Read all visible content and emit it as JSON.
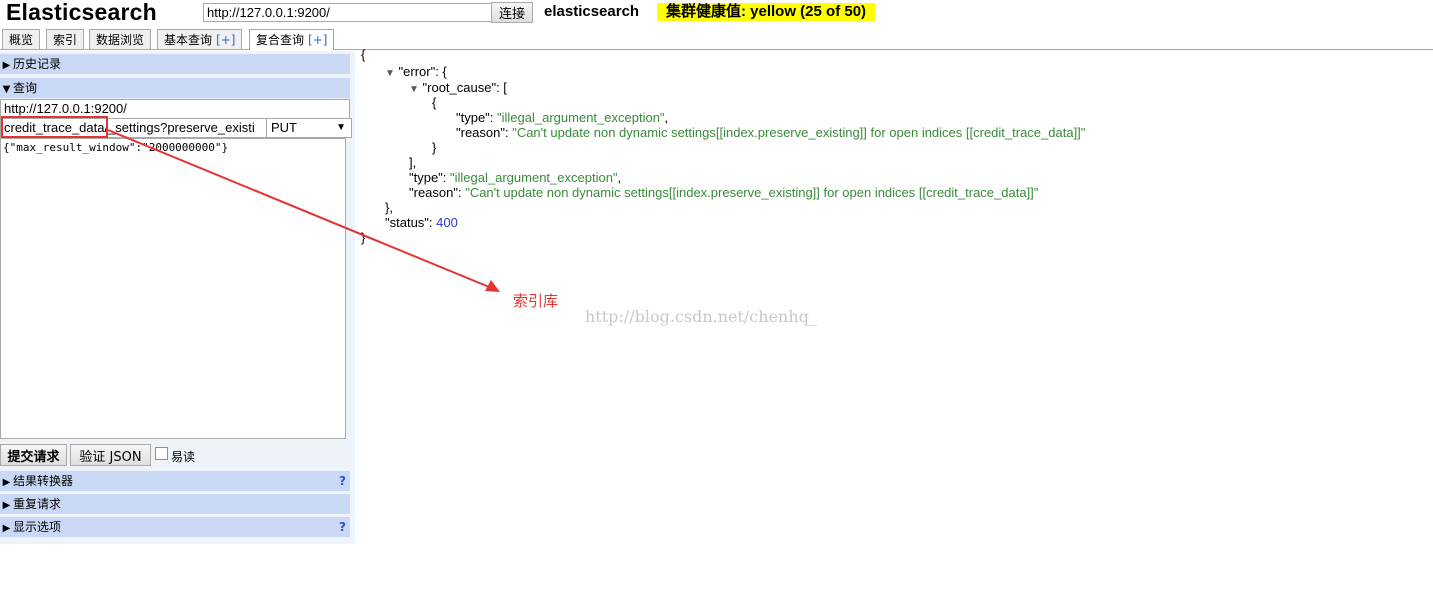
{
  "header": {
    "app_title": "Elasticsearch",
    "url_value": "http://127.0.0.1:9200/",
    "connect_label": "连接",
    "cluster_name": "elasticsearch",
    "health_text": "集群健康值: yellow (25 of 50)",
    "health_color": "#ffff00"
  },
  "tabs": [
    {
      "label": "概览",
      "plus": ""
    },
    {
      "label": "索引",
      "plus": ""
    },
    {
      "label": "数据浏览",
      "plus": ""
    },
    {
      "label": "基本查询",
      "plus": "[+]"
    },
    {
      "label": "复合查询",
      "plus": "[+]"
    }
  ],
  "left_panel": {
    "history_label": "历史记录",
    "query_label": "查询",
    "endpoint_value": "http://127.0.0.1:9200/",
    "path_value": "credit_trace_data/_settings?preserve_existi",
    "method_value": "PUT",
    "body_value": "{\"max_result_window\":\"2000000000\"}",
    "submit_label": "提交请求",
    "validate_label": "验证 JSON",
    "readable_label": "易读",
    "transformer_label": "结果转换器",
    "repeat_label": "重复请求",
    "display_label": "显示选项",
    "help_mark": "?"
  },
  "annotation": {
    "label": "索引库",
    "color": "#e53333",
    "watermark": "http://blog.csdn.net/chenhq_"
  },
  "response": {
    "type_value": "\"illegal_argument_exception\"",
    "reason_value": "\"Can't update non dynamic settings[[index.preserve_existing]] for open indices [[credit_trace_data]]\"",
    "status_value": "400"
  }
}
